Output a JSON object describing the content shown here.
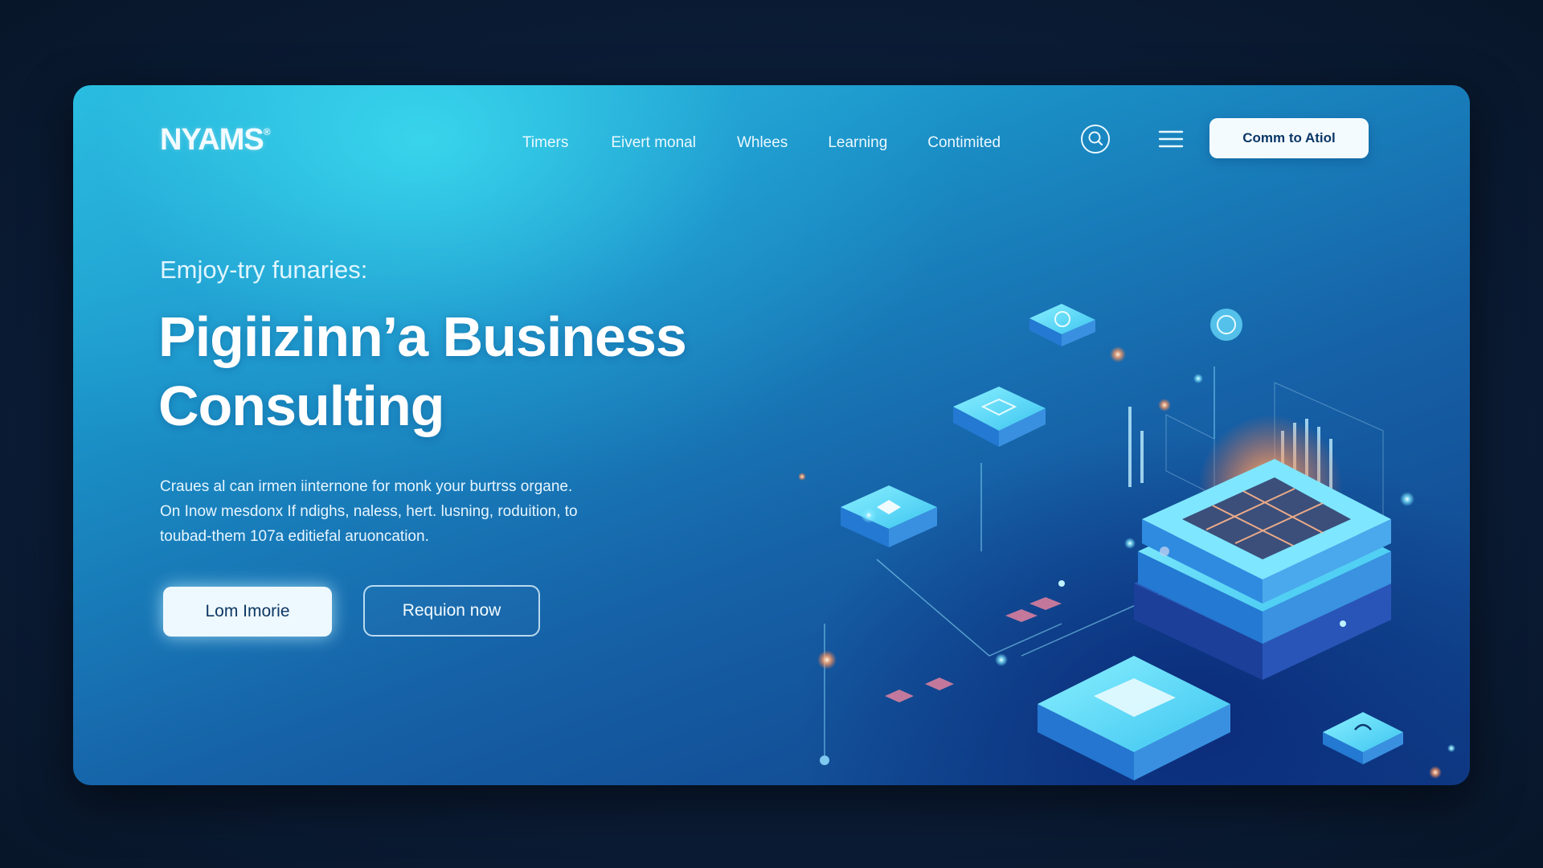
{
  "brand": {
    "logo_text": "NYAMS",
    "logo_mark": "®"
  },
  "nav": {
    "items": [
      {
        "label": "Timers"
      },
      {
        "label": "Eivert monal"
      },
      {
        "label": "Whlees"
      },
      {
        "label": "Learning"
      },
      {
        "label": "Contimited"
      }
    ],
    "cta_label": "Comm to Atiol"
  },
  "hero": {
    "eyebrow": "Emjoy-try funaries:",
    "headline_line1": "Pigiizinn’a Business",
    "headline_line2": "Consulting",
    "description_line1": "Craues al can irmen iinternone for monk your burtrss organe.",
    "description_line2": "On Inow mesdonx If ndighs, naless, hert. lusning, roduition, to",
    "description_line3": "toubad-them 107a editiefal aruoncation.",
    "primary_button": "Lom Imorie",
    "secondary_button": "Requion now"
  },
  "icons": {
    "search": "search-icon",
    "menu": "hamburger-menu-icon"
  },
  "colors": {
    "page_background": "#0c1e3a",
    "card_gradient_light": "#2bc6e2",
    "card_gradient_dark": "#0f3c85",
    "button_light": "#eef9ff",
    "button_text": "#0d3763",
    "glow_accent": "#ff9a5c"
  }
}
